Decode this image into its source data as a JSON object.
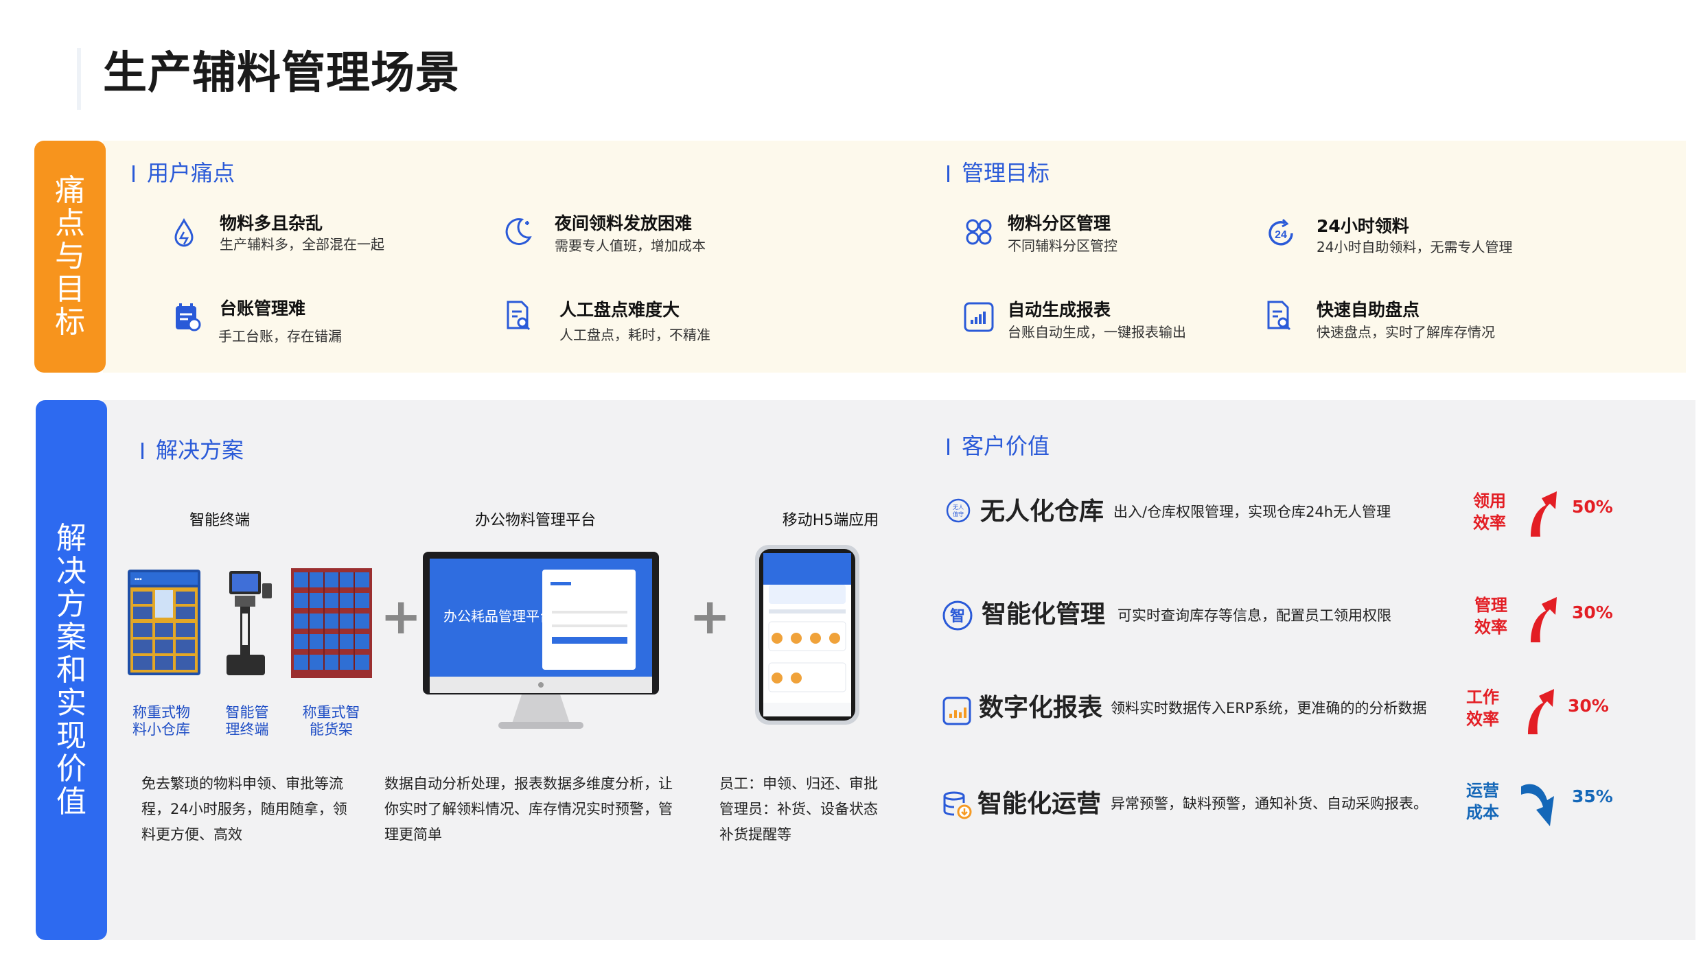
{
  "page": {
    "title": "生产辅料管理场景"
  },
  "side_tags": {
    "top": "痛点与目标",
    "bottom": "解决方案和实现价值"
  },
  "pain": {
    "heading": "用户痛点",
    "items": [
      {
        "title": "物料多且杂乱",
        "desc": "生产辅料多，全部混在一起",
        "icon": "drop-icon"
      },
      {
        "title": "夜间领料发放困难",
        "desc": "需要专人值班，增加成本",
        "icon": "moon-icon"
      },
      {
        "title": "台账管理难",
        "desc": "手工台账，存在错漏",
        "icon": "ledger-icon"
      },
      {
        "title": "人工盘点难度大",
        "desc": "人工盘点，耗时，不精准",
        "icon": "doc-search-icon"
      }
    ]
  },
  "goal": {
    "heading": "管理目标",
    "items": [
      {
        "title": "物料分区管理",
        "desc": "不同辅料分区管控",
        "icon": "zones-icon"
      },
      {
        "title": "24小时领料",
        "desc": "24小时自助领料，无需专人管理",
        "icon": "clock-24-icon"
      },
      {
        "title": "自动生成报表",
        "desc": "台账自动生成，一键报表输出",
        "icon": "chart-icon"
      },
      {
        "title": "快速自助盘点",
        "desc": "快速盘点，实时了解库存情况",
        "icon": "doc-search-icon"
      }
    ]
  },
  "solution": {
    "heading": "解决方案",
    "groups": [
      {
        "label": "智能终端",
        "desc": "免去繁琐的物料申领、审批等流程，24小时服务，随用随拿，领料更方便、高效"
      },
      {
        "label": "办公物料管理平台",
        "desc": "数据自动分析处理，报表数据多维度分析，让你实时了解领料情况、库存情况实时预警，管理更简单",
        "screen_text": "办公耗品管理平台"
      },
      {
        "label": "移动H5端应用",
        "desc": "员工：申领、归还、审批\n管理员：补货、设备状态\n补货提醒等"
      }
    ],
    "devices": [
      {
        "caption": "称重式物\n料小仓库"
      },
      {
        "caption": "智能管\n理终端"
      },
      {
        "caption": "称重式智\n能货架"
      }
    ],
    "plus": "+"
  },
  "value": {
    "heading": "客户价值",
    "items": [
      {
        "name": "无人化仓库",
        "desc": "出入/仓库权限管理，实现仓库24h无人管理",
        "metric": "领用\n效率",
        "pct": "50%",
        "trend": "up",
        "icon": "unmanned-icon",
        "icon_text": "无人\n值守"
      },
      {
        "name": "智能化管理",
        "desc": "可实时查询库存等信息，配置员工领用权限",
        "metric": "管理\n效率",
        "pct": "30%",
        "trend": "up",
        "icon": "smart-icon",
        "icon_text": "智"
      },
      {
        "name": "数字化报表",
        "desc": "领料实时数据传入ERP系统，更准确的的分析数据",
        "metric": "工作\n效率",
        "pct": "30%",
        "trend": "up",
        "icon": "report-icon"
      },
      {
        "name": "智能化运营",
        "desc": "异常预警，缺料预警，通知补货、自动采购报表。",
        "metric": "运营\n成本",
        "pct": "35%",
        "trend": "down",
        "icon": "database-icon"
      }
    ]
  },
  "colors": {
    "orange": "#f7941d",
    "blue": "#2d6af0",
    "accent": "#2a5ad8",
    "up": "#e31e24",
    "down": "#1467b8"
  }
}
